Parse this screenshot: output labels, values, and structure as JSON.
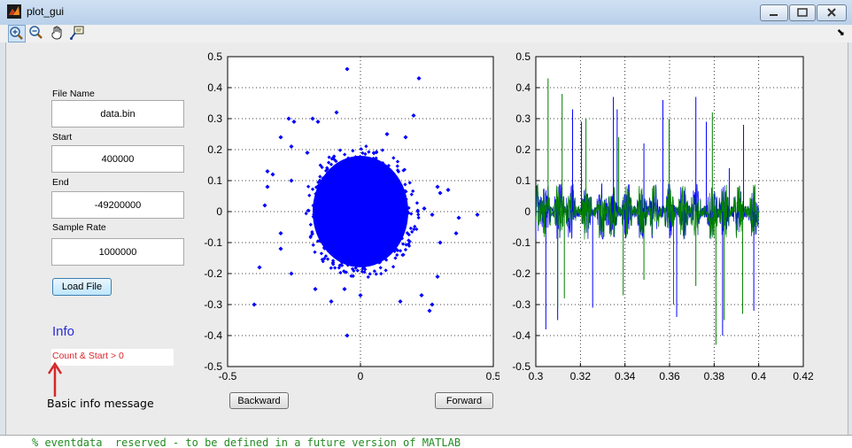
{
  "window": {
    "title": "plot_gui",
    "toolbar_overflow": "⬊"
  },
  "icons": [
    "matlab-app-icon",
    "zoom-in-icon",
    "zoom-out-icon",
    "pan-hand-icon",
    "data-cursor-icon",
    "minimize-icon",
    "maximize-icon",
    "close-icon"
  ],
  "form": {
    "file_name_label": "File Name",
    "file_name_value": "data.bin",
    "start_label": "Start",
    "start_value": "400000",
    "end_label": "End",
    "end_value": "-49200000",
    "sample_rate_label": "Sample Rate",
    "sample_rate_value": "1000000",
    "load_button": "Load File"
  },
  "info": {
    "title": "Info",
    "message": "Count & Start > 0"
  },
  "nav": {
    "backward": "Backward",
    "forward": "Forward"
  },
  "annotation": {
    "text": "Basic info message",
    "color": "#d62728"
  },
  "code_strip": "% eventdata  reserved - to be defined in a future version of MATLAB",
  "colors": {
    "info_title": "#2b2bd8",
    "info_message": "#e0252b",
    "series_blue": "#0000ff",
    "series_green": "#008000"
  },
  "chart_data": [
    {
      "type": "scatter",
      "xlim": [
        -0.5,
        0.5
      ],
      "ylim": [
        -0.5,
        0.5
      ],
      "xticks": [
        "-0.5",
        "0",
        "0.5"
      ],
      "yticks": [
        "0.5",
        "0.4",
        "0.3",
        "0.2",
        "0.1",
        "0",
        "-0.1",
        "-0.2",
        "-0.3",
        "-0.4",
        "-0.5"
      ],
      "grid": true,
      "marker_color": "#0000ff",
      "cluster": {
        "cx": 0.0,
        "cy": 0.0,
        "rx": 0.18,
        "ry": 0.18
      },
      "outliers": [
        [
          -0.05,
          0.46
        ],
        [
          0.22,
          0.43
        ],
        [
          -0.27,
          0.3
        ],
        [
          -0.25,
          0.29
        ],
        [
          -0.18,
          0.3
        ],
        [
          -0.16,
          0.29
        ],
        [
          -0.09,
          0.32
        ],
        [
          0.2,
          0.31
        ],
        [
          -0.3,
          0.24
        ],
        [
          -0.26,
          0.21
        ],
        [
          -0.2,
          0.19
        ],
        [
          0.17,
          0.24
        ],
        [
          0.1,
          0.25
        ],
        [
          -0.35,
          0.13
        ],
        [
          -0.33,
          0.12
        ],
        [
          -0.26,
          0.1
        ],
        [
          0.29,
          0.08
        ],
        [
          0.33,
          0.07
        ],
        [
          -0.35,
          0.08
        ],
        [
          -0.36,
          0.02
        ],
        [
          0.27,
          -0.01
        ],
        [
          0.44,
          -0.01
        ],
        [
          0.37,
          -0.02
        ],
        [
          -0.3,
          -0.07
        ],
        [
          0.36,
          -0.07
        ],
        [
          0.3,
          -0.1
        ],
        [
          -0.3,
          -0.12
        ],
        [
          -0.38,
          -0.18
        ],
        [
          -0.4,
          -0.3
        ],
        [
          -0.26,
          -0.2
        ],
        [
          0.29,
          -0.21
        ],
        [
          -0.17,
          -0.25
        ],
        [
          -0.11,
          -0.29
        ],
        [
          -0.06,
          -0.25
        ],
        [
          0.0,
          -0.27
        ],
        [
          0.23,
          -0.27
        ],
        [
          0.15,
          -0.29
        ],
        [
          0.26,
          -0.32
        ],
        [
          0.27,
          -0.3
        ],
        [
          -0.05,
          -0.4
        ],
        [
          0.24,
          0.01
        ],
        [
          0.3,
          0.06
        ]
      ]
    },
    {
      "type": "line",
      "xlim": [
        0.3,
        0.42
      ],
      "ylim": [
        -0.5,
        0.5
      ],
      "xticks": [
        "0.3",
        "0.32",
        "0.34",
        "0.36",
        "0.38",
        "0.4",
        "0.42"
      ],
      "yticks": [
        "0.5",
        "0.4",
        "0.3",
        "0.2",
        "0.1",
        "0",
        "-0.1",
        "-0.2",
        "-0.3",
        "-0.4",
        "-0.5"
      ],
      "grid": true,
      "series_colors": [
        "#0000ff",
        "#008000"
      ],
      "x_range": [
        0.3,
        0.4
      ],
      "bursts": [
        0.3,
        0.3045,
        0.3105,
        0.3158,
        0.3228,
        0.3295,
        0.3342,
        0.3408,
        0.3475,
        0.3532,
        0.3601,
        0.3662,
        0.3718,
        0.3792,
        0.3845,
        0.391,
        0.3978
      ],
      "spikes_blue": [
        [
          0.3045,
          -0.38
        ],
        [
          0.3165,
          0.33
        ],
        [
          0.3255,
          -0.31
        ],
        [
          0.3348,
          0.37
        ],
        [
          0.3365,
          0.33
        ],
        [
          0.3485,
          0.22
        ],
        [
          0.357,
          0.36
        ],
        [
          0.3632,
          -0.34
        ],
        [
          0.3718,
          0.37
        ],
        [
          0.3765,
          0.29
        ],
        [
          0.3838,
          -0.4
        ],
        [
          0.3868,
          0.14
        ],
        [
          0.3932,
          0.28
        ],
        [
          0.3978,
          -0.32
        ],
        [
          0.3205,
          0.29
        ],
        [
          0.3098,
          -0.35
        ]
      ],
      "spikes_green": [
        [
          0.3055,
          0.43
        ],
        [
          0.3118,
          0.38
        ],
        [
          0.3128,
          -0.28
        ],
        [
          0.3225,
          0.3
        ],
        [
          0.3098,
          -0.31
        ],
        [
          0.3372,
          0.24
        ],
        [
          0.3392,
          -0.27
        ],
        [
          0.3485,
          -0.22
        ],
        [
          0.3598,
          0.3
        ],
        [
          0.3618,
          -0.3
        ],
        [
          0.3718,
          -0.24
        ],
        [
          0.3792,
          0.32
        ],
        [
          0.3808,
          -0.43
        ],
        [
          0.3845,
          -0.35
        ],
        [
          0.3928,
          -0.33
        ]
      ]
    }
  ]
}
